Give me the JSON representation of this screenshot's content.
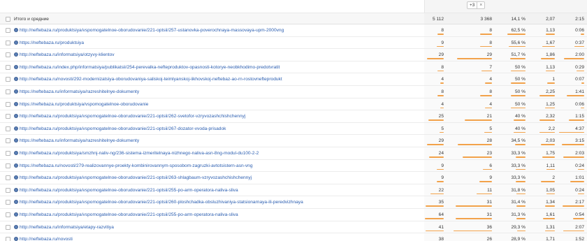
{
  "segment": {
    "count_label": "+3",
    "close_glyph": "×"
  },
  "colors": {
    "link": "#2a5db0",
    "bar": "#f2a24a",
    "bar_muted": "#c4c4c4"
  },
  "total": {
    "label": "Итого и средние",
    "c1": "5 112",
    "c2": "3 368",
    "c3": "14,1 %",
    "c4": "2,07",
    "c5": "2:15"
  },
  "rows": [
    {
      "url": "http://neftebaza.ru/produktsiya/vspomogatelnoe-oborudovanie/221-optsii/257-ustanovka-poverochnaya-massovaya-upm-2000vng",
      "c1": "8",
      "c2": "8",
      "c3": "62,5 %",
      "c4": "1,13",
      "c5": "0:06",
      "p1": 0.33,
      "p2": 0.3,
      "p3": 0.62,
      "p4": 0.35,
      "p5": 0.15
    },
    {
      "url": "https://neftebaza.ru/produktsiya",
      "c1": "9",
      "c2": "8",
      "c3": "55,6 %",
      "c4": "1,67",
      "c5": "0:37",
      "p1": 0.38,
      "p2": 0.3,
      "p3": 0.56,
      "p4": 0.5,
      "p5": 0.4
    },
    {
      "url": "http://neftebaza.ru/informatsiya/otzyvy-klientov",
      "c1": "29",
      "c2": "29",
      "c3": "51,7 %",
      "c4": "1,86",
      "c5": "2:00",
      "p1": 0.9,
      "p2": 0.9,
      "p3": 0.52,
      "p4": 0.55,
      "p5": 0.8
    },
    {
      "url": "http://neftebaza.ru/index.php/informatsiya/publikatsii/254-perevalka-nefteproduktov-opasnosti-kotorye-neobkhodimo-predotvratit",
      "c1": "8",
      "c2": "7",
      "c3": "50 %",
      "c4": "1,13",
      "c5": "0:29",
      "p1": 0.33,
      "p2": 0.27,
      "p3": 0.5,
      "p4": 0.35,
      "p5": 0.3
    },
    {
      "url": "http://neftebaza.ru/novosti/292-modernizatsiya-oborudovaniya-saliskoj-teimlyanskoj-iikhovskoj-neftebaz-ao-rn-rostovnefteprodukt",
      "c1": "4",
      "c2": "4",
      "c3": "50 %",
      "c4": "1",
      "c5": "0:07",
      "p1": 0.2,
      "p2": 0.18,
      "p3": 0.5,
      "p4": 0.3,
      "p5": 0.12
    },
    {
      "url": "https://neftebaza.ru/informatsiya/razreshitelnye-dokumenty",
      "c1": "8",
      "c2": "8",
      "c3": "50 %",
      "c4": "2,25",
      "c5": "1:41",
      "p1": 0.33,
      "p2": 0.3,
      "p3": 0.5,
      "p4": 0.6,
      "p5": 0.7
    },
    {
      "url": "https://neftebaza.ru/produktsiya/vspomogatelnoe-oborudovanie",
      "c1": "4",
      "c2": "4",
      "c3": "50 %",
      "c4": "1,25",
      "c5": "0:06",
      "p1": 0.2,
      "p2": 0.18,
      "p3": 0.5,
      "p4": 0.4,
      "p5": 0.15
    },
    {
      "url": "http://neftebaza.ru/produktsiya/vspomogatelnoe-oborudovanie/221-optsii/262-svetofor-vzryvozashchishchennyj",
      "c1": "25",
      "c2": "21",
      "c3": "40 %",
      "c4": "2,32",
      "c5": "1:15",
      "p1": 0.8,
      "p2": 0.7,
      "p3": 0.4,
      "p4": 0.62,
      "p5": 0.6
    },
    {
      "url": "http://neftebaza.ru/produktsiya/vspomogatelnoe-oborudovanie/221-optsii/267-dozator-vvoda-prisadok",
      "c1": "5",
      "c2": "5",
      "c3": "40 %",
      "c4": "2,2",
      "c5": "4:37",
      "p1": 0.22,
      "p2": 0.2,
      "p3": 0.4,
      "p4": 0.6,
      "p5": 1.0
    },
    {
      "url": "https://neftebaza.ru/informatsiya/razreshitelnye-dokumenty",
      "c1": "29",
      "c2": "28",
      "c3": "34,5 %",
      "c4": "2,03",
      "c5": "3:15",
      "p1": 0.9,
      "p2": 0.88,
      "p3": 0.35,
      "p4": 0.55,
      "p5": 0.88
    },
    {
      "url": "http://neftebaza.ru/produktsiya/smzhnj-naliv-ng/236-sistema-izmeritelnaya-nizhnego-naliva-asn-8ng-modul-du100-2-2",
      "c1": "24",
      "c2": "23",
      "c3": "33,3 %",
      "c4": "1,75",
      "c5": "2:03",
      "p1": 0.78,
      "p2": 0.75,
      "p3": 0.33,
      "p4": 0.5,
      "p5": 0.82
    },
    {
      "url": "https://neftebaza.ru/novosti/279-realizovannye-proekty-kombinirovannym-sposobom-zagruzki-avtotsistern-asn-vng",
      "c1": "9",
      "c2": "6",
      "c3": "33,3 %",
      "c4": "1,11",
      "c5": "0:24",
      "p1": 0.38,
      "p2": 0.24,
      "p3": 0.33,
      "p4": 0.34,
      "p5": 0.25
    },
    {
      "url": "http://neftebaza.ru/produktsiya/vspomogatelnoe-oborudovanie/221-optsii/263-shlagbaum-vzryvozashchishchennyj",
      "c1": "9",
      "c2": "9",
      "c3": "33,3 %",
      "c4": "2",
      "c5": "1:01",
      "p1": 0.38,
      "p2": 0.33,
      "p3": 0.33,
      "p4": 0.55,
      "p5": 0.55
    },
    {
      "url": "http://neftebaza.ru/produktsiya/vspomogatelnoe-oborudovanie/221-optsii/255-po-arm-operatora-naliva-sliva",
      "c1": "22",
      "c2": "11",
      "c3": "31,8 %",
      "c4": "1,05",
      "c5": "0:24",
      "p1": 0.72,
      "p2": 0.4,
      "p3": 0.32,
      "p4": 0.32,
      "p5": 0.25
    },
    {
      "url": "http://neftebaza.ru/produktsiya/vspomogatelnoe-oborudovanie/221-optsii/260-ploshchadka-obsluzhivaniya-statsionarnaya-ili-peredvizhnaya",
      "c1": "35",
      "c2": "31",
      "c3": "31,4 %",
      "c4": "1,34",
      "c5": "2:17",
      "p1": 0.95,
      "p2": 0.92,
      "p3": 0.31,
      "p4": 0.4,
      "p5": 0.85
    },
    {
      "url": "http://neftebaza.ru/produktsiya/vspomogatelnoe-oborudovanie/221-optsii/255-po-arm-operatora-naliva-sliva",
      "c1": "64",
      "c2": "31",
      "c3": "31,3 %",
      "c4": "1,61",
      "c5": "0:54",
      "p1": 1.0,
      "p2": 0.92,
      "p3": 0.31,
      "p4": 0.48,
      "p5": 0.45
    },
    {
      "url": "http://neftebaza.ru/informatsiya/etapy-razvitiya",
      "c1": "41",
      "c2": "36",
      "c3": "29,3 %",
      "c4": "1,31",
      "c5": "2:07",
      "p1": 0.98,
      "p2": 0.98,
      "p3": 0.29,
      "p4": 0.4,
      "p5": 0.84
    },
    {
      "url": "http://neftebaza.ru/novosti",
      "c1": "38",
      "c2": "26",
      "c3": "28,9 %",
      "c4": "1,71",
      "c5": "1:52",
      "p1": 0.96,
      "p2": 0.8,
      "p3": 0.29,
      "p4": 0.5,
      "p5": 0.76
    }
  ]
}
